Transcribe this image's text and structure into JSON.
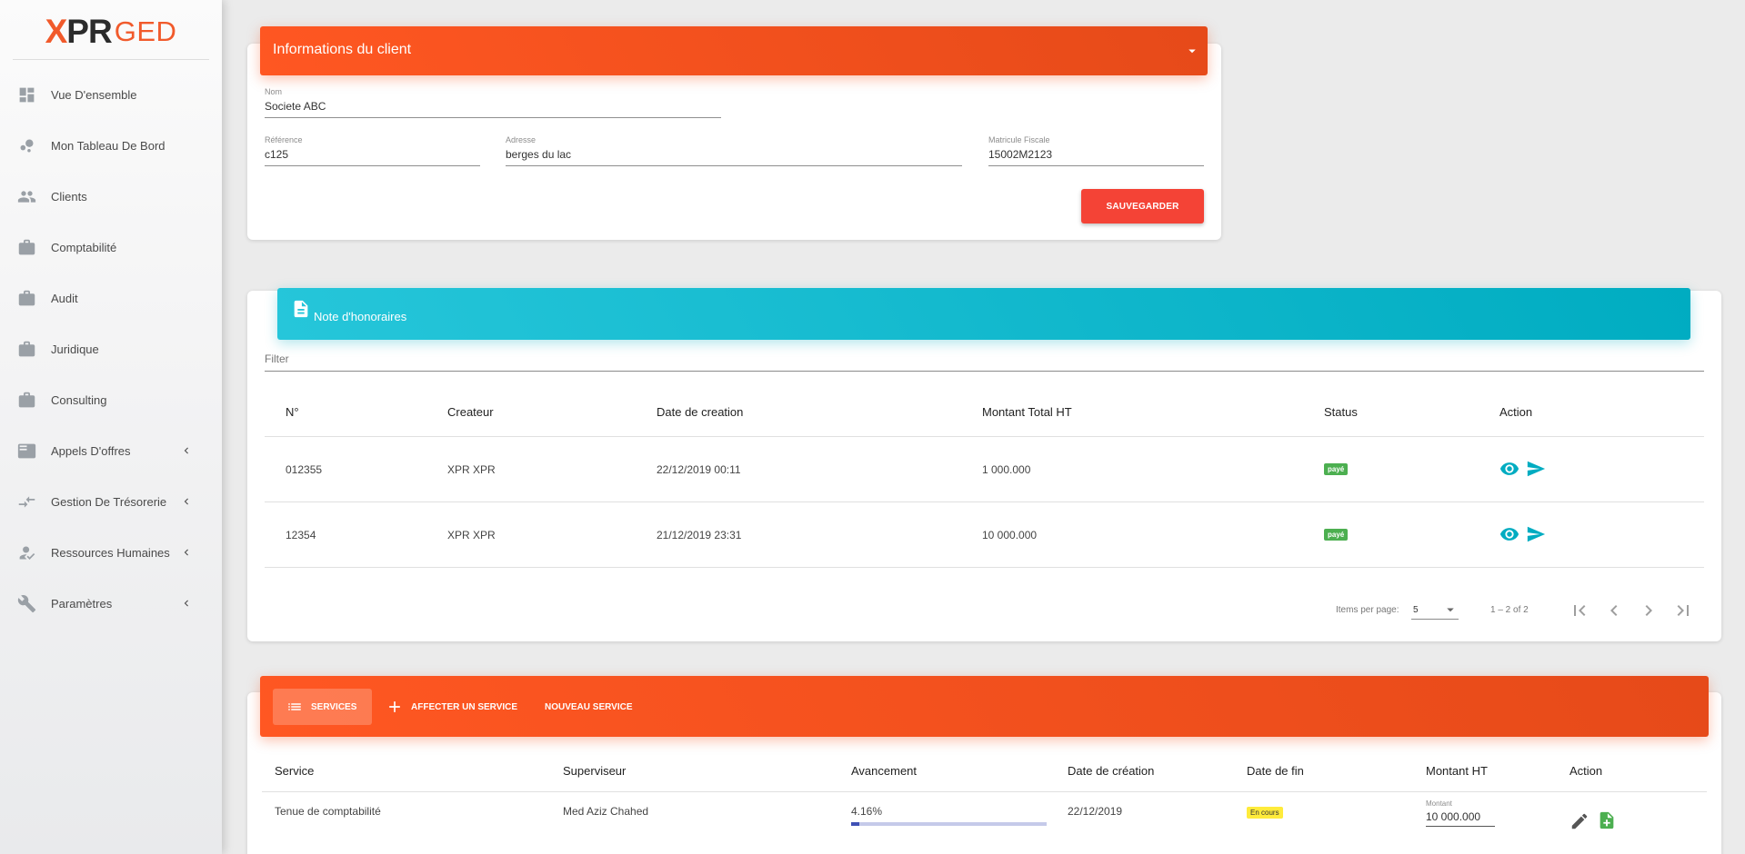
{
  "logo": {
    "brand_x": "X",
    "brand_pr": "PR",
    "brand_ged": "GED"
  },
  "sidebar": {
    "items": [
      {
        "label": "Vue D'ensemble",
        "icon": "dashboard-icon",
        "has_submenu": false
      },
      {
        "label": "Mon Tableau De Bord",
        "icon": "bubble-chart-icon",
        "has_submenu": false
      },
      {
        "label": "Clients",
        "icon": "people-icon",
        "has_submenu": false
      },
      {
        "label": "Comptabilité",
        "icon": "briefcase-icon",
        "has_submenu": false
      },
      {
        "label": "Audit",
        "icon": "briefcase-icon",
        "has_submenu": false
      },
      {
        "label": "Juridique",
        "icon": "briefcase-icon",
        "has_submenu": false
      },
      {
        "label": "Consulting",
        "icon": "briefcase-icon",
        "has_submenu": false
      },
      {
        "label": "Appels D'offres",
        "icon": "featured-play-list-icon",
        "has_submenu": true
      },
      {
        "label": "Gestion De Trésorerie",
        "icon": "compare-arrows-icon",
        "has_submenu": true
      },
      {
        "label": "Ressources Humaines",
        "icon": "how-to-reg-icon",
        "has_submenu": true
      },
      {
        "label": "Paramètres",
        "icon": "wrench-icon",
        "has_submenu": true
      }
    ]
  },
  "client": {
    "title": "Informations du client",
    "nom_label": "Nom",
    "nom_value": "Societe ABC",
    "reference_label": "Référence",
    "reference_value": "c125",
    "adresse_label": "Adresse",
    "adresse_value": "berges du lac",
    "matricule_label": "Matricule Fiscale",
    "matricule_value": "15002M2123",
    "save_label": "SAUVEGARDER"
  },
  "notes": {
    "title": "Note d'honoraires",
    "filter_placeholder": "Filter",
    "columns": [
      "N°",
      "Createur",
      "Date de creation",
      "Montant Total HT",
      "Status",
      "Action"
    ],
    "rows": [
      {
        "numero": "012355",
        "createur": "XPR XPR",
        "date": "22/12/2019 00:11",
        "montant": "1 000.000",
        "status": "payé"
      },
      {
        "numero": "12354",
        "createur": "XPR XPR",
        "date": "21/12/2019 23:31",
        "montant": "10 000.000",
        "status": "payé"
      }
    ],
    "paginator": {
      "items_per_page_label": "Items per page:",
      "page_size": "5",
      "range_label": "1 – 2 of 2"
    }
  },
  "services": {
    "tabs": {
      "services": "SERVICES",
      "affecter": "AFFECTER UN SERVICE",
      "nouveau": "NOUVEAU SERVICE"
    },
    "columns": [
      "Service",
      "Superviseur",
      "Avancement",
      "Date de création",
      "Date de fin",
      "Montant HT",
      "Action"
    ],
    "rows": [
      {
        "service": "Tenue de comptabilité",
        "superviseur": "Med Aziz Chahed",
        "avancement_label": "4.16%",
        "avancement": 4.16,
        "date_creation": "22/12/2019",
        "date_fin": "En cours",
        "montant_label": "Montant",
        "montant": "10 000.000"
      }
    ]
  },
  "colors": {
    "orange": "#ff5722",
    "cyan": "#00acc1",
    "red_button": "#f44336",
    "paid_green": "#4caf50",
    "in_progress_yellow": "#ffeb3b",
    "action_teal": "#00acc1",
    "progress_blue": "#3f51b5"
  }
}
